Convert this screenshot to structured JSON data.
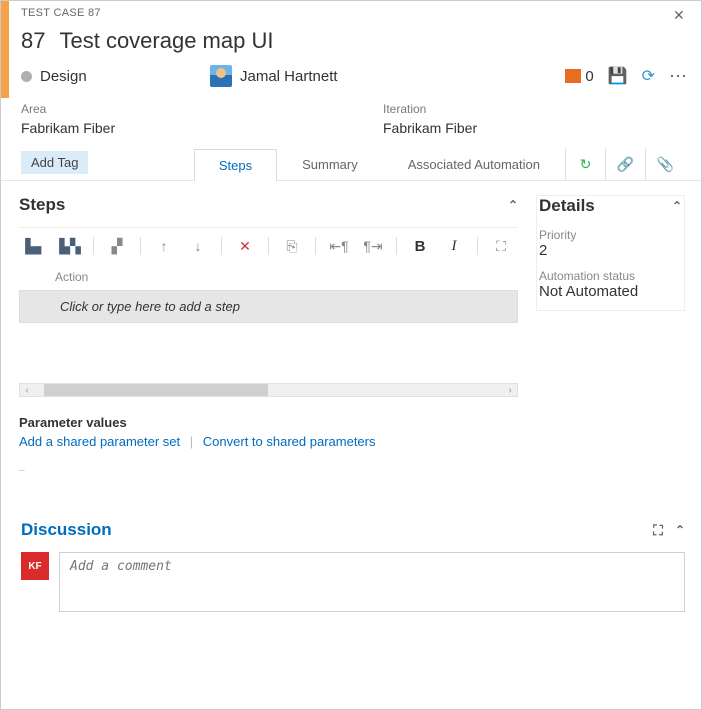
{
  "header": {
    "type_label": "TEST CASE 87",
    "id": "87",
    "title": "Test coverage map UI"
  },
  "meta": {
    "state": "Design",
    "assignee": "Jamal Hartnett",
    "comment_count": "0"
  },
  "classification": {
    "area_label": "Area",
    "area_value": "Fabrikam Fiber",
    "iteration_label": "Iteration",
    "iteration_value": "Fabrikam Fiber"
  },
  "tags": {
    "add_tag_label": "Add Tag"
  },
  "tabs": {
    "steps": "Steps",
    "summary": "Summary",
    "automation": "Associated Automation"
  },
  "steps_section": {
    "title": "Steps",
    "action_header": "Action",
    "placeholder": "Click or type here to add a step"
  },
  "parameters": {
    "title": "Parameter values",
    "add_shared": "Add a shared parameter set",
    "convert": "Convert to shared parameters"
  },
  "details": {
    "title": "Details",
    "priority_label": "Priority",
    "priority_value": "2",
    "automation_label": "Automation status",
    "automation_value": "Not Automated"
  },
  "discussion": {
    "title": "Discussion",
    "avatar_initials": "KF",
    "placeholder": "Add a comment"
  }
}
